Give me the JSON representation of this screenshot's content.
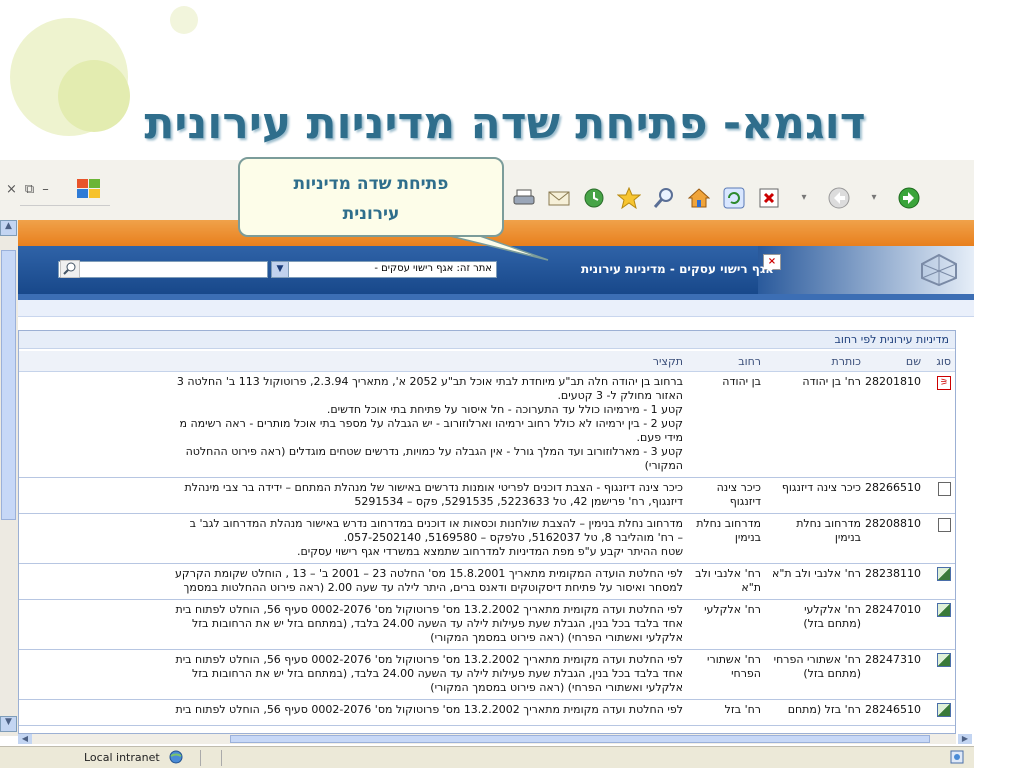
{
  "slide": {
    "title": "דוגמא- פתיחת שדה מדיניות עירונית"
  },
  "callout": {
    "line1": "פתיחת שדה מדיניות",
    "line2": "עירונית"
  },
  "browser": {
    "window_controls": {
      "close": "×",
      "restore": "⧉",
      "minimize": "–"
    },
    "header": {
      "title": "אגף רישוי עסקים - מדיניות עירונית",
      "site_select_value": "אתר זה: אגף רישוי עסקים -"
    },
    "status": {
      "zone": "Local intranet"
    }
  },
  "panel": {
    "title": "מדיניות עירונית לפי רחוב",
    "columns": {
      "type": "סוג",
      "name": "שם",
      "address": "כותרת",
      "street": "רחוב",
      "summary": "תקציר"
    },
    "rows": [
      {
        "icon": "pdf-icon",
        "name": "28201810",
        "address": "רח' בן יהודה",
        "street": "בן יהודה",
        "summary": [
          "ברחוב בן יהודה חלה תב\"ע מיוחדת לבתי אוכל תב\"ע 2052 א', מתאריך 2.3.94, פרוטוקול 113 ב' החלטה 3",
          "האזור מחולק ל- 3 קטעים.",
          "קטע 1 - מירמיהו כולל עד התערוכה - חל איסור על פתיחת בתי אוכל חדשים.",
          "קטע 2 - בין ירמיהו לא כולל רחוב ירמיהו וארלוזורוב - יש הגבלה על מספר בתי אוכל מותרים - ראה רשימה מ",
          "מידי פעם.",
          "קטע 3 - מארלוזורוב ועד המלך גורל - אין הגבלה על כמויות, נדרשים שטחים מוגדלים (ראה פירוט ההחלטה",
          "המקורי)"
        ]
      },
      {
        "icon": "doc-icon",
        "name": "28266510",
        "address": "כיכר צינה דיזנגוף",
        "street": "כיכר צינה דיזנגוף",
        "summary": [
          "כיכר צינה דיזנגוף - הצבת דוכנים לפריטי אומנות נדרשים באישור של מנהלת המתחם – ידידה בר צבי מינהלת",
          "דיזנגוף, רח' פרישמן 42, טל 5223633, 5291535, פקס – 5291534"
        ]
      },
      {
        "icon": "doc-icon",
        "name": "28208810",
        "address": "מדרחוב נחלת בנימין",
        "street": "מדרחוב נחלת בנימין",
        "summary": [
          "מדרחוב נחלת בנימין – להצבת שולחנות וכסאות או דוכנים במדרחוב נדרש באישור מנהלת המדרחוב לגב' ב",
          "– רח' מוהליבר 8, טל 5162037, טלפקס – 5169580, 057-2502140.",
          "שטח ההיתר יקבע ע\"פ מפת המדיניות למדרחוב שתמצא במשרדי אגף רישוי עסקים."
        ]
      },
      {
        "icon": "img-icon",
        "name": "28238110",
        "address": "רח' אלנבי ולב ת\"א",
        "street": "רח' אלנבי ולב ת\"א",
        "summary": [
          "לפי החלטת הועדה המקומית מתאריך 15.8.2001 מס' החלטה 23 – 2001 ב' – 13 , הוחלט שקומת הקרקע",
          "למסחר ואיסור על פתיחת דיסקוטקים ודאנס ברים, היתר לילה עד שעה 2.00 (ראה פירוט ההחלטות במסמך"
        ]
      },
      {
        "icon": "img-icon",
        "name": "28247010",
        "address": "רח' אלקלעי (מתחם בזל)",
        "street": "רח' אלקלעי",
        "summary": [
          "לפי החלטת ועדה מקומית מתאריך 13.2.2002 מס' פרוטוקול מס' 0002-2076 סעיף 56, הוחלט לפתוח בית",
          "אחד בלבד בכל בנין, הגבלת שעת פעילות לילה עד השעה 24.00 בלבד, (במתחם בזל יש את הרחובות בזל",
          "אלקלעי ואשתורי הפרחי) (ראה פירוט במסמך המקורי)"
        ]
      },
      {
        "icon": "img-icon",
        "name": "28247310",
        "address": "רח' אשתורי הפרחי (מתחם בזל)",
        "street": "רח' אשתורי הפרחי",
        "summary": [
          "לפי החלטת ועדה מקומית מתאריך 13.2.2002 מס' פרוטוקול מס' 0002-2076 סעיף 56, הוחלט לפתוח בית",
          "אחד בלבד בכל בנין, הגבלת שעת פעילות לילה עד השעה 24.00 בלבד, (במתחם בזל יש את הרחובות בזל",
          "אלקלעי ואשתורי הפרחי) (ראה פירוט במסמך המקורי)"
        ]
      },
      {
        "icon": "img-icon",
        "name": "28246510",
        "address": "רח' בזל (מתחם",
        "street": "רח' בזל",
        "summary": [
          "לפי החלטת ועדה מקומית מתאריך 13.2.2002 מס' פרוטוקול מס' 0002-2076 סעיף 56, הוחלט לפתוח בית"
        ]
      }
    ]
  }
}
